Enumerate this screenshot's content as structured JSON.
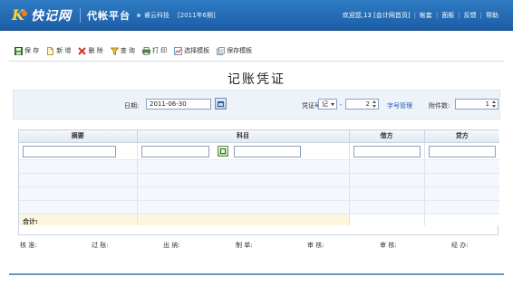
{
  "header": {
    "logo_text": "快记网",
    "product": "代帐平台",
    "company": "睿云科技",
    "period": "[2011年6期]",
    "nav": [
      "欢迎您,13 [会计网首页]",
      "帐套",
      "面板",
      "反馈",
      "帮助"
    ]
  },
  "toolbar": {
    "buttons": [
      {
        "label": "保 存",
        "icon": "save-icon"
      },
      {
        "label": "新 增",
        "icon": "new-document-icon"
      },
      {
        "label": "删 除",
        "icon": "delete-icon"
      },
      {
        "label": "查 询",
        "icon": "query-icon"
      },
      {
        "label": "打 印",
        "icon": "print-icon"
      },
      {
        "label": "选择模板",
        "icon": "select-template-icon"
      },
      {
        "label": "保存模板",
        "icon": "save-template-icon"
      }
    ]
  },
  "title": "记账凭证",
  "form": {
    "date_label": "日期:",
    "date_value": "2011-06-30",
    "voucher_no_label": "凭证号:",
    "voucher_type": "记",
    "voucher_dash": "-",
    "voucher_no": "2",
    "word_manage_link": "字号管理",
    "attachments_label": "附件数:",
    "attachments_value": "1"
  },
  "table": {
    "columns": [
      "摘要",
      "科目",
      "借方",
      "贷方"
    ],
    "total_label": "合计:"
  },
  "signatures": [
    "核 准:",
    "过 账:",
    "出 纳:",
    "制 单:",
    "审 核:",
    "审 核:",
    "经 办:"
  ],
  "colors": {
    "header_bg": "#1b5da6",
    "link": "#1d5fb3",
    "total_row_bg": "#fdf6dc"
  }
}
